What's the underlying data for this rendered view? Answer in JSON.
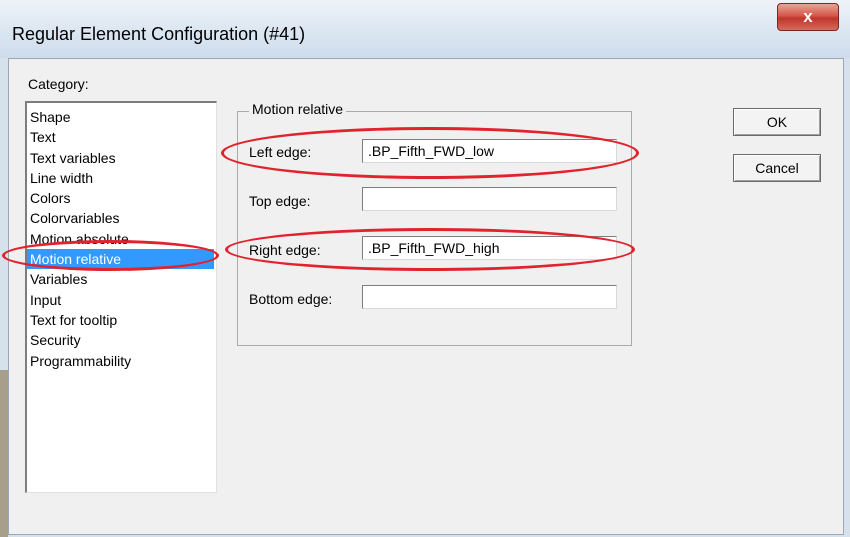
{
  "window": {
    "title": "Regular Element Configuration (#41)",
    "close_glyph": "x"
  },
  "category": {
    "label": "Category:",
    "items": [
      "Shape",
      "Text",
      "Text variables",
      "Line width",
      "Colors",
      "Colorvariables",
      "Motion absolute",
      "Motion relative",
      "Variables",
      "Input",
      "Text for tooltip",
      "Security",
      "Programmability"
    ],
    "selected": "Motion relative"
  },
  "group": {
    "title": "Motion relative"
  },
  "fields": {
    "left_label": "Left edge:",
    "left_value": ".BP_Fifth_FWD_low",
    "top_label": "Top edge:",
    "top_value": "",
    "right_label": "Right edge:",
    "right_value": ".BP_Fifth_FWD_high",
    "bottom_label": "Bottom edge:",
    "bottom_value": ""
  },
  "buttons": {
    "ok": "OK",
    "cancel": "Cancel"
  },
  "annotation_color": "#e0232d"
}
